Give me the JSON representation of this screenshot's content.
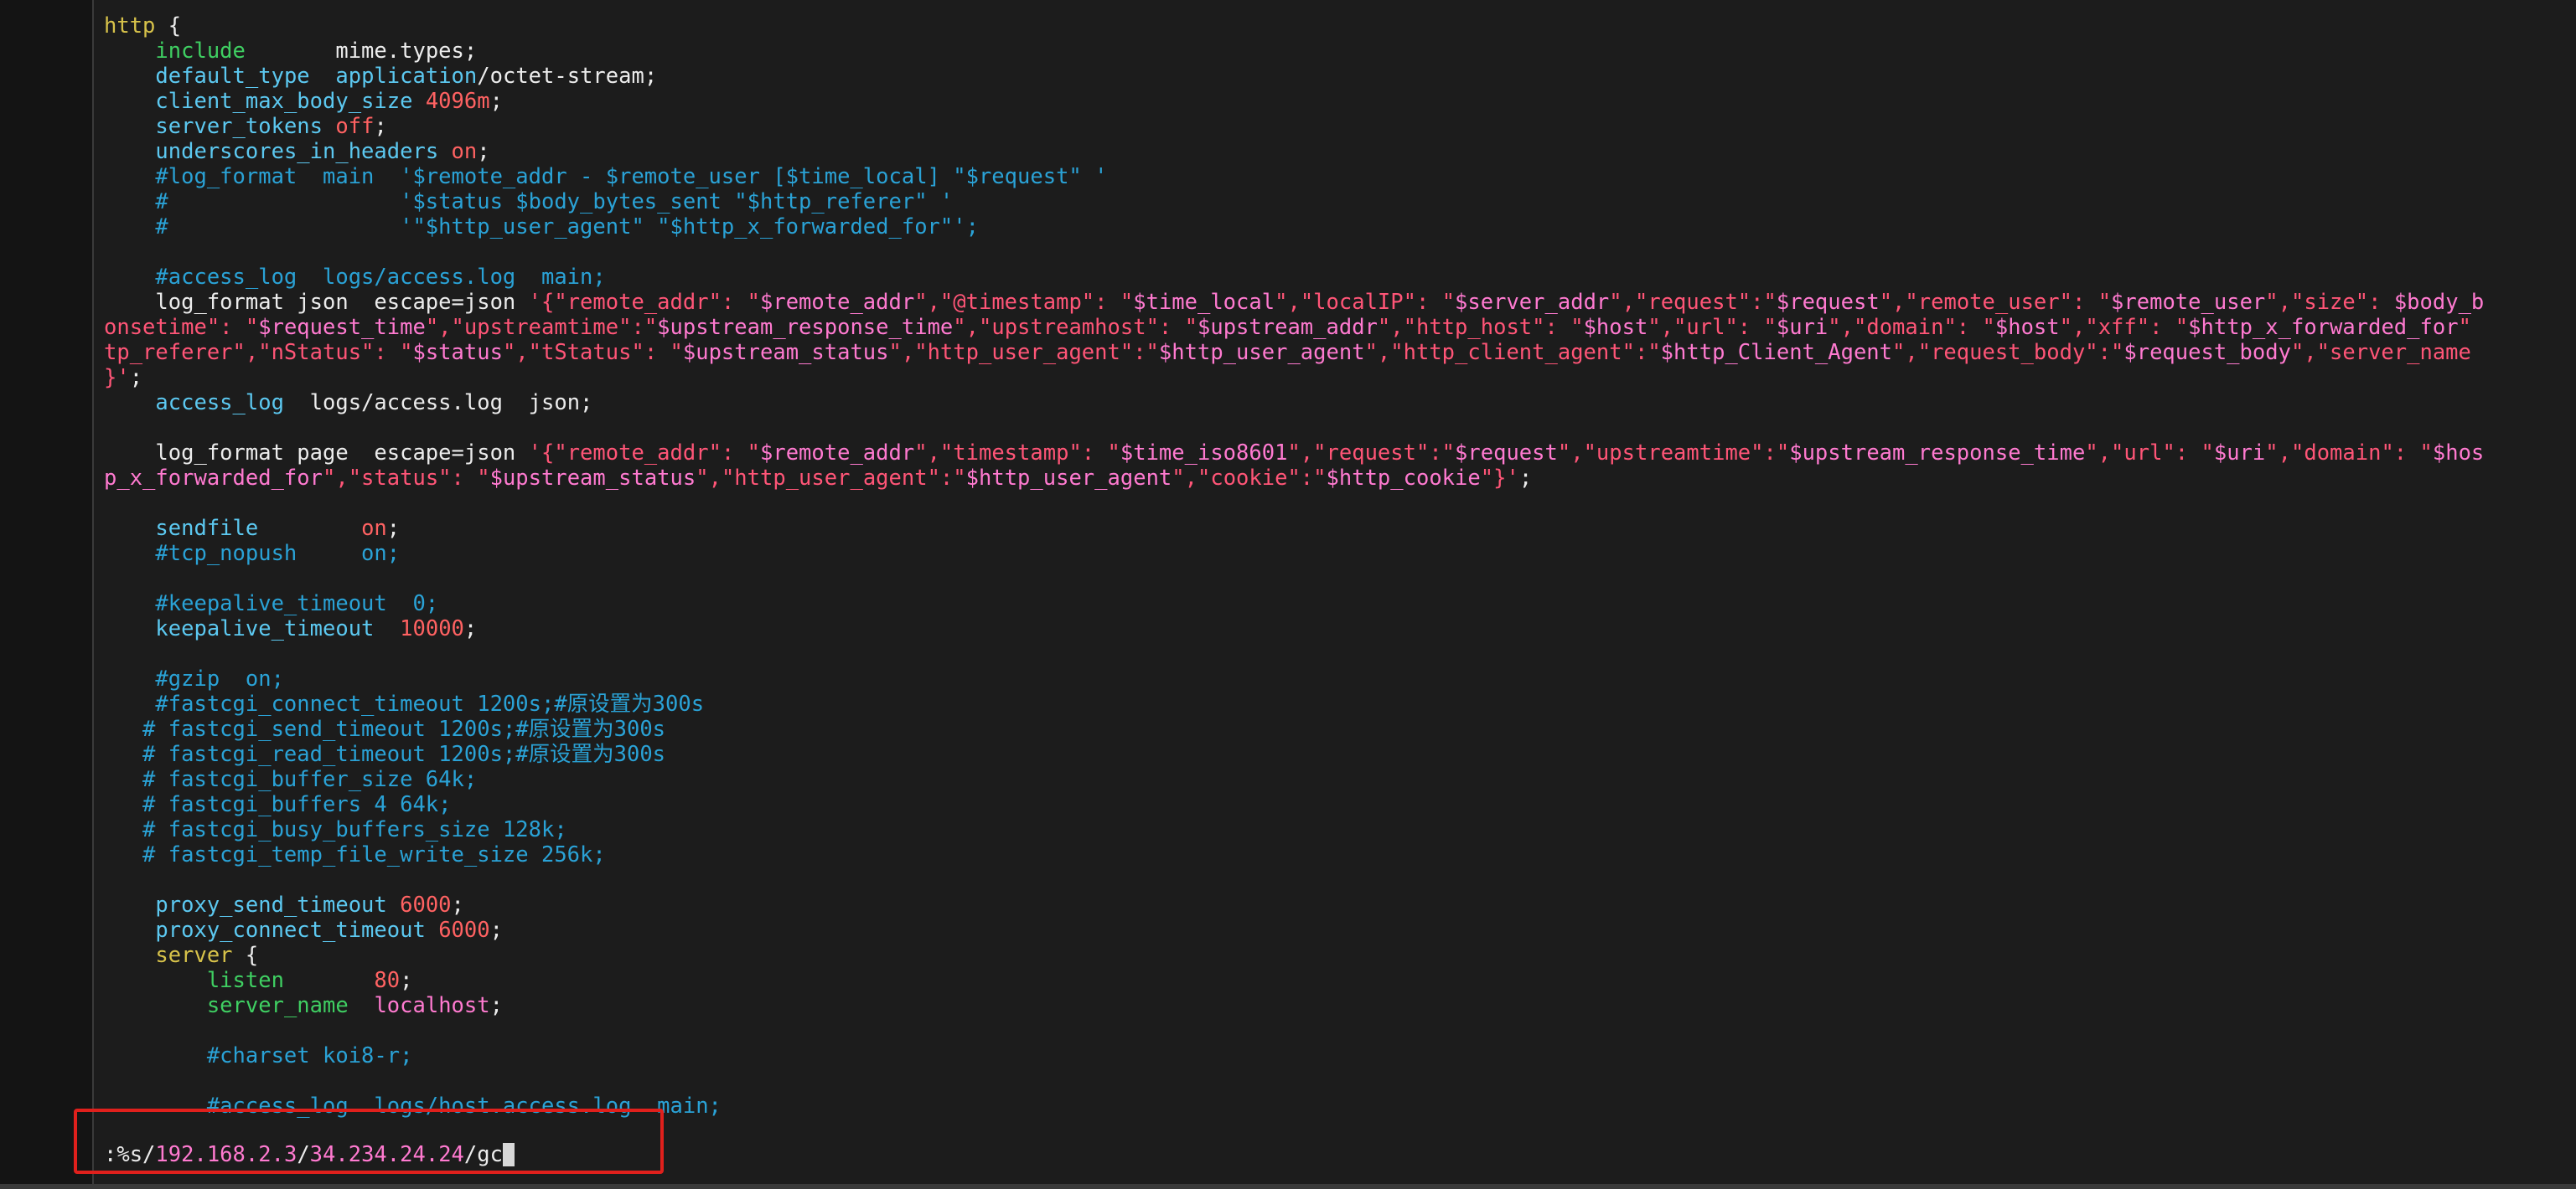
{
  "lines": [
    [
      {
        "t": "http",
        "c": "kw"
      },
      {
        "t": " {"
      }
    ],
    [
      {
        "t": "    "
      },
      {
        "t": "include",
        "c": "grn"
      },
      {
        "t": "       mime.types;"
      }
    ],
    [
      {
        "t": "    "
      },
      {
        "t": "default_type",
        "c": "dir"
      },
      {
        "t": "  "
      },
      {
        "t": "application",
        "c": "dir"
      },
      {
        "t": "/octet-stream;"
      }
    ],
    [
      {
        "t": "    "
      },
      {
        "t": "client_max_body_size",
        "c": "dir"
      },
      {
        "t": " "
      },
      {
        "t": "4096m",
        "c": "num"
      },
      {
        "t": ";"
      }
    ],
    [
      {
        "t": "    "
      },
      {
        "t": "server_tokens",
        "c": "dir"
      },
      {
        "t": " "
      },
      {
        "t": "off",
        "c": "num"
      },
      {
        "t": ";"
      }
    ],
    [
      {
        "t": "    "
      },
      {
        "t": "underscores_in_headers",
        "c": "dir"
      },
      {
        "t": " "
      },
      {
        "t": "on",
        "c": "num"
      },
      {
        "t": ";"
      }
    ],
    [
      {
        "t": "    #log_format  main  '$remote_addr - $remote_user [$time_local] \"$request\" '",
        "c": "cmt"
      }
    ],
    [
      {
        "t": "    #                  '$status $body_bytes_sent \"$http_referer\" '",
        "c": "cmt"
      }
    ],
    [
      {
        "t": "    #                  '\"$http_user_agent\" \"$http_x_forwarded_for\"';",
        "c": "cmt"
      }
    ],
    [
      {
        "t": ""
      }
    ],
    [
      {
        "t": "    #access_log  logs/access.log  main;",
        "c": "cmt"
      }
    ],
    [
      {
        "t": "    log_format json  escape=json "
      },
      {
        "t": "'{\"remote_addr\": \"",
        "c": "str"
      },
      {
        "t": "$remote_addr",
        "c": "var"
      },
      {
        "t": "\",\"@timestamp\": \"",
        "c": "str"
      },
      {
        "t": "$time_local",
        "c": "var"
      },
      {
        "t": "\",\"localIP\": \"",
        "c": "str"
      },
      {
        "t": "$server_addr",
        "c": "var"
      },
      {
        "t": "\",\"request\":\"",
        "c": "str"
      },
      {
        "t": "$request",
        "c": "var"
      },
      {
        "t": "\",\"remote_user\": \"",
        "c": "str"
      },
      {
        "t": "$remote_user",
        "c": "var"
      },
      {
        "t": "\",\"size\": ",
        "c": "str"
      },
      {
        "t": "$body_b",
        "c": "var"
      }
    ],
    [
      {
        "t": "onsetime\": \"",
        "c": "str"
      },
      {
        "t": "$request_time",
        "c": "var"
      },
      {
        "t": "\",\"upstreamtime\":\"",
        "c": "str"
      },
      {
        "t": "$upstream_response_time",
        "c": "var"
      },
      {
        "t": "\",\"upstreamhost\": \"",
        "c": "str"
      },
      {
        "t": "$upstream_addr",
        "c": "var"
      },
      {
        "t": "\",\"http_host\": \"",
        "c": "str"
      },
      {
        "t": "$host",
        "c": "var"
      },
      {
        "t": "\",\"url\": \"",
        "c": "str"
      },
      {
        "t": "$uri",
        "c": "var"
      },
      {
        "t": "\",\"domain\": \"",
        "c": "str"
      },
      {
        "t": "$host",
        "c": "var"
      },
      {
        "t": "\",\"xff\": \"",
        "c": "str"
      },
      {
        "t": "$http_x_forwarded_for",
        "c": "var"
      },
      {
        "t": "\"",
        "c": "str"
      }
    ],
    [
      {
        "t": "tp_referer\",\"nStatus\": \"",
        "c": "str"
      },
      {
        "t": "$status",
        "c": "var"
      },
      {
        "t": "\",\"tStatus\": \"",
        "c": "str"
      },
      {
        "t": "$upstream_status",
        "c": "var"
      },
      {
        "t": "\",\"http_user_agent\":\"",
        "c": "str"
      },
      {
        "t": "$http_user_agent",
        "c": "var"
      },
      {
        "t": "\",\"http_client_agent\":\"",
        "c": "str"
      },
      {
        "t": "$http_Client_Agent",
        "c": "var"
      },
      {
        "t": "\",\"request_body\":\"",
        "c": "str"
      },
      {
        "t": "$request_body",
        "c": "var"
      },
      {
        "t": "\",\"server_name",
        "c": "str"
      }
    ],
    [
      {
        "t": "}'",
        "c": "str"
      },
      {
        "t": ";"
      }
    ],
    [
      {
        "t": "    "
      },
      {
        "t": "access_log",
        "c": "dir"
      },
      {
        "t": "  logs/access.log  json;"
      }
    ],
    [
      {
        "t": ""
      }
    ],
    [
      {
        "t": "    log_format page  escape=json "
      },
      {
        "t": "'{\"remote_addr\": \"",
        "c": "str"
      },
      {
        "t": "$remote_addr",
        "c": "var"
      },
      {
        "t": "\",\"timestamp\": \"",
        "c": "str"
      },
      {
        "t": "$time_iso8601",
        "c": "var"
      },
      {
        "t": "\",\"request\":\"",
        "c": "str"
      },
      {
        "t": "$request",
        "c": "var"
      },
      {
        "t": "\",\"upstreamtime\":\"",
        "c": "str"
      },
      {
        "t": "$upstream_response_time",
        "c": "var"
      },
      {
        "t": "\",\"url\": \"",
        "c": "str"
      },
      {
        "t": "$uri",
        "c": "var"
      },
      {
        "t": "\",\"domain\": \"",
        "c": "str"
      },
      {
        "t": "$hos",
        "c": "var"
      }
    ],
    [
      {
        "t": "p_x_forwarded_for",
        "c": "var"
      },
      {
        "t": "\",\"status\": \"",
        "c": "str"
      },
      {
        "t": "$upstream_status",
        "c": "var"
      },
      {
        "t": "\",\"http_user_agent\":\"",
        "c": "str"
      },
      {
        "t": "$http_user_agent",
        "c": "var"
      },
      {
        "t": "\",\"cookie\":\"",
        "c": "str"
      },
      {
        "t": "$http_cookie",
        "c": "var"
      },
      {
        "t": "\"}'",
        "c": "str"
      },
      {
        "t": ";"
      }
    ],
    [
      {
        "t": ""
      }
    ],
    [
      {
        "t": "    "
      },
      {
        "t": "sendfile",
        "c": "dir"
      },
      {
        "t": "        "
      },
      {
        "t": "on",
        "c": "num"
      },
      {
        "t": ";"
      }
    ],
    [
      {
        "t": "    #tcp_nopush     on;",
        "c": "cmt"
      }
    ],
    [
      {
        "t": ""
      }
    ],
    [
      {
        "t": "    #keepalive_timeout  0;",
        "c": "cmt"
      }
    ],
    [
      {
        "t": "    "
      },
      {
        "t": "keepalive_timeout",
        "c": "dir"
      },
      {
        "t": "  "
      },
      {
        "t": "10000",
        "c": "num"
      },
      {
        "t": ";"
      }
    ],
    [
      {
        "t": ""
      }
    ],
    [
      {
        "t": "    #gzip  on;",
        "c": "cmt"
      }
    ],
    [
      {
        "t": "    #fastcgi_connect_timeout 1200s;#原设置为300s",
        "c": "cmt"
      }
    ],
    [
      {
        "t": "   # fastcgi_send_timeout 1200s;#原设置为300s",
        "c": "cmt"
      }
    ],
    [
      {
        "t": "   # fastcgi_read_timeout 1200s;#原设置为300s",
        "c": "cmt"
      }
    ],
    [
      {
        "t": "   # fastcgi_buffer_size 64k;",
        "c": "cmt"
      }
    ],
    [
      {
        "t": "   # fastcgi_buffers 4 64k;",
        "c": "cmt"
      }
    ],
    [
      {
        "t": "   # fastcgi_busy_buffers_size 128k;",
        "c": "cmt"
      }
    ],
    [
      {
        "t": "   # fastcgi_temp_file_write_size 256k;",
        "c": "cmt"
      }
    ],
    [
      {
        "t": ""
      }
    ],
    [
      {
        "t": "    "
      },
      {
        "t": "proxy_send_timeout",
        "c": "dir"
      },
      {
        "t": " "
      },
      {
        "t": "6000",
        "c": "num"
      },
      {
        "t": ";"
      }
    ],
    [
      {
        "t": "    "
      },
      {
        "t": "proxy_connect_timeout",
        "c": "dir"
      },
      {
        "t": " "
      },
      {
        "t": "6000",
        "c": "num"
      },
      {
        "t": ";"
      }
    ],
    [
      {
        "t": "    "
      },
      {
        "t": "server",
        "c": "kw"
      },
      {
        "t": " {"
      }
    ],
    [
      {
        "t": "        "
      },
      {
        "t": "listen",
        "c": "grn"
      },
      {
        "t": "       "
      },
      {
        "t": "80",
        "c": "num"
      },
      {
        "t": ";"
      }
    ],
    [
      {
        "t": "        "
      },
      {
        "t": "server_name",
        "c": "grn"
      },
      {
        "t": "  "
      },
      {
        "t": "localhost",
        "c": "var"
      },
      {
        "t": ";"
      }
    ],
    [
      {
        "t": ""
      }
    ],
    [
      {
        "t": "        #charset koi8-r;",
        "c": "cmt"
      }
    ],
    [
      {
        "t": ""
      }
    ],
    [
      {
        "t": "        #access_log  logs/host.access.log  main;",
        "c": "cmt"
      }
    ]
  ],
  "cmdline": {
    "prefix": ":%s/",
    "search": "192.168.2.3",
    "sep1": "/",
    "replace": "34.234.24.24",
    "sep2": "/gc"
  },
  "colors": {
    "keyword": "#d7c24a",
    "directive": "#5cc8f0",
    "green": "#3fcf62",
    "string": "#ff5577",
    "variable": "#ff7ad0",
    "number": "#ff6262",
    "comment": "#2aa2d6",
    "highlight_box": "#e0201c"
  }
}
